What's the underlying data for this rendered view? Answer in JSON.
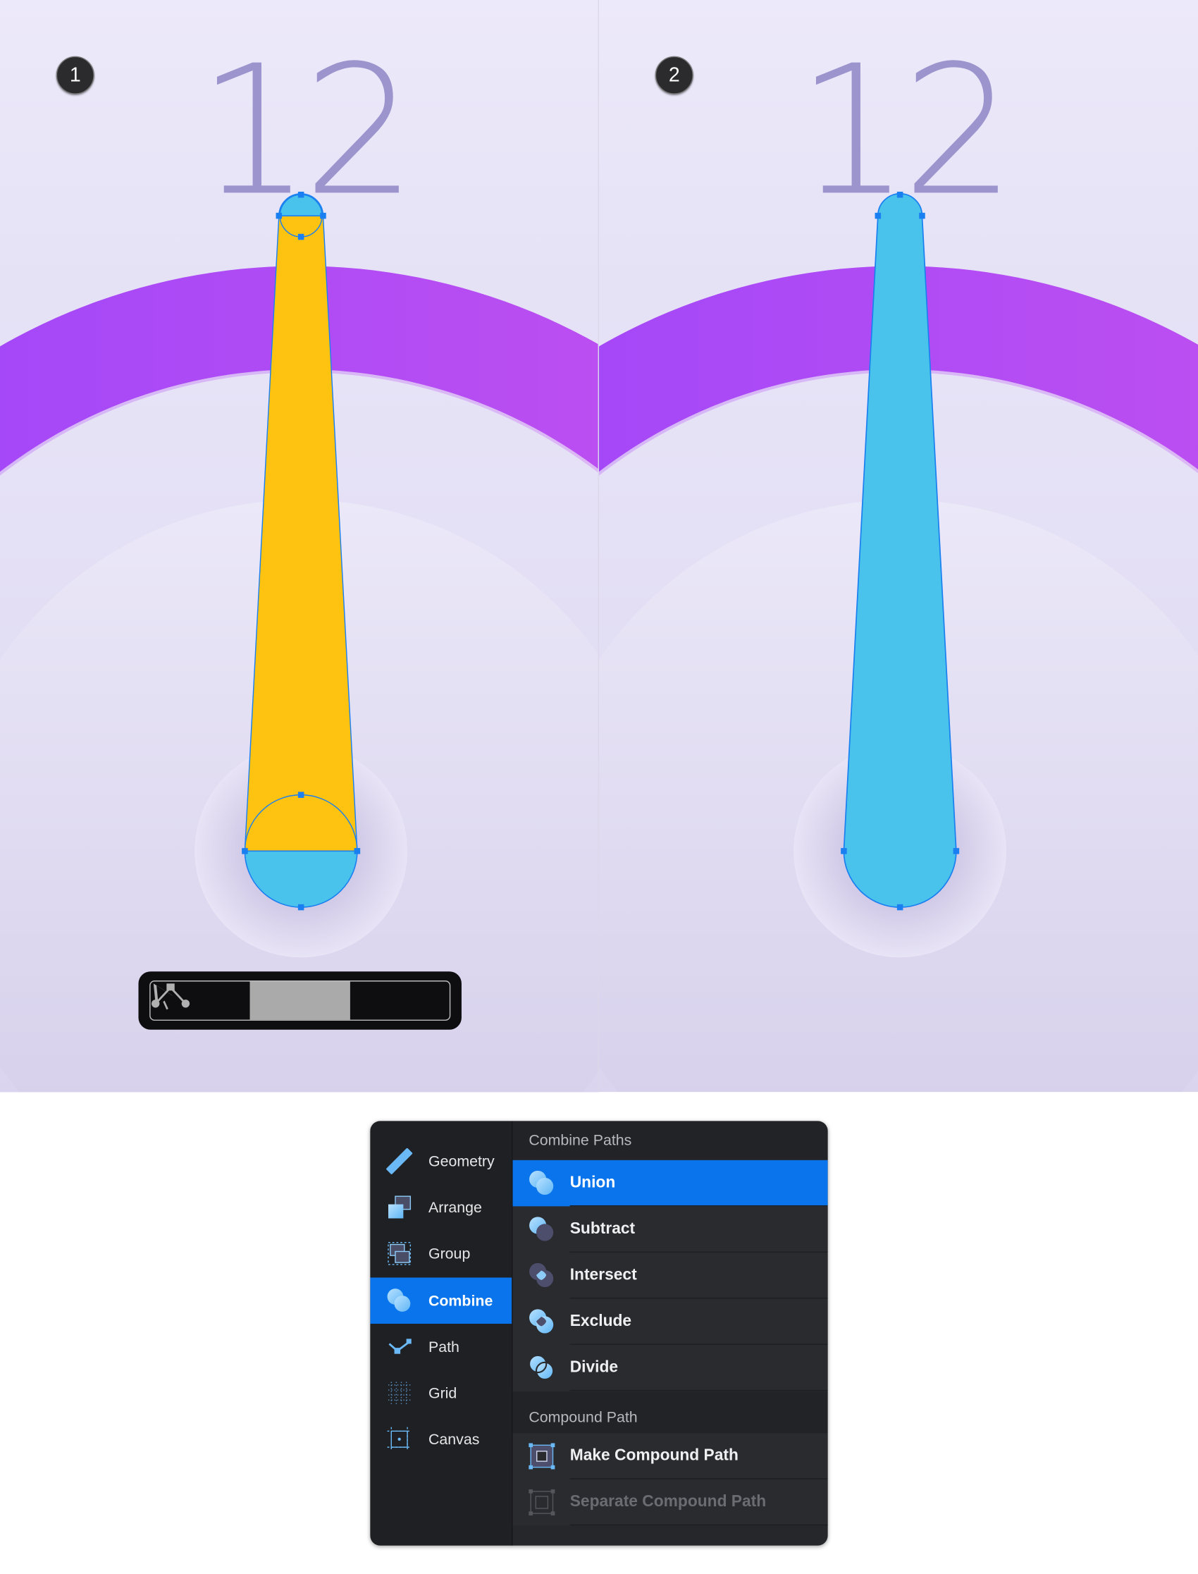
{
  "steps": [
    {
      "number": "1",
      "clock_label": "12"
    },
    {
      "number": "2",
      "clock_label": "12"
    }
  ],
  "colors": {
    "needle_before": "#fec311",
    "needle_cap": "#4ac3ec",
    "needle_after": "#4ac3ec",
    "anchor": "#1a7ff0",
    "arc": "#a64cf5",
    "numeral": "#9c94cd",
    "accent": "#0a74ec"
  },
  "toolbar": {
    "tools": [
      {
        "icon": "select-arrow-icon",
        "active": false
      },
      {
        "icon": "subselect-arrow-plus-icon",
        "active": true
      },
      {
        "icon": "path-nodes-icon",
        "active": false
      }
    ]
  },
  "menu": {
    "sidebar": [
      {
        "label": "Geometry",
        "icon": "ruler-icon"
      },
      {
        "label": "Arrange",
        "icon": "arrange-icon"
      },
      {
        "label": "Group",
        "icon": "group-icon"
      },
      {
        "label": "Combine",
        "icon": "combine-icon",
        "active": true
      },
      {
        "label": "Path",
        "icon": "path-icon"
      },
      {
        "label": "Grid",
        "icon": "grid-icon"
      },
      {
        "label": "Canvas",
        "icon": "canvas-icon"
      }
    ],
    "combine_header": "Combine Paths",
    "combine_items": [
      {
        "label": "Union",
        "icon": "union-icon",
        "active": true
      },
      {
        "label": "Subtract",
        "icon": "subtract-icon"
      },
      {
        "label": "Intersect",
        "icon": "intersect-icon"
      },
      {
        "label": "Exclude",
        "icon": "exclude-icon"
      },
      {
        "label": "Divide",
        "icon": "divide-icon"
      }
    ],
    "compound_header": "Compound Path",
    "compound_items": [
      {
        "label": "Make Compound Path",
        "icon": "make-compound-icon"
      },
      {
        "label": "Separate Compound Path",
        "icon": "separate-compound-icon",
        "disabled": true
      }
    ]
  }
}
